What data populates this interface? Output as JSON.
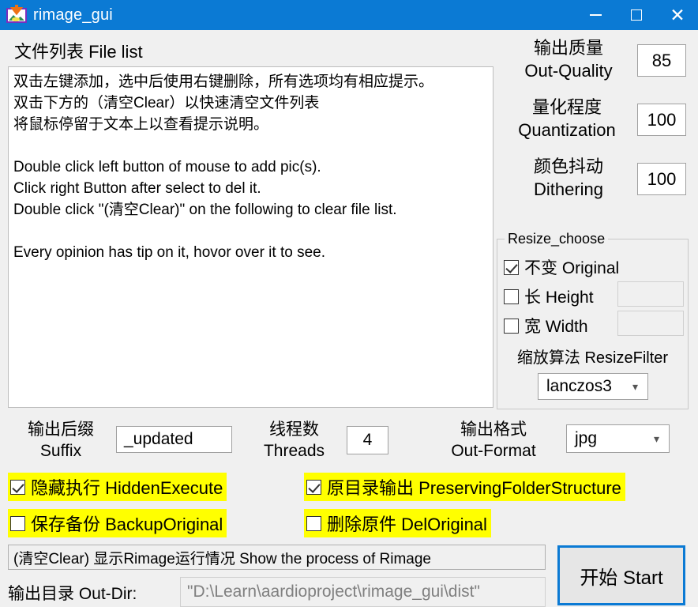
{
  "window": {
    "title": "rimage_gui",
    "icon": "picture-download-icon",
    "minimize_label": "—",
    "maximize_label": "□",
    "close_label": "✕",
    "titlebar_color": "#0b7ad4"
  },
  "file_list": {
    "title": "文件列表 File list",
    "content": "双击左键添加，选中后使用右键删除，所有选项均有相应提示。\n双击下方的（清空Clear）以快速清空文件列表\n将鼠标停留于文本上以查看提示说明。\n\nDouble click left button of mouse to add pic(s).\nClick right Button after select to del it.\nDouble click \"(清空Clear)\" on the following to clear file list.\n\nEvery opinion has tip on it, hovor over it to see."
  },
  "params": {
    "quality": {
      "label": "输出质量\nOut-Quality",
      "value": "85"
    },
    "quantization": {
      "label": "量化程度\nQuantization",
      "value": "100"
    },
    "dithering": {
      "label": "颜色抖动\nDithering",
      "value": "100"
    }
  },
  "resize": {
    "legend": "Resize_choose",
    "original": {
      "label": "不变 Original",
      "checked": true
    },
    "height": {
      "label": "长 Height",
      "checked": false,
      "value": ""
    },
    "width": {
      "label": "宽 Width",
      "checked": false,
      "value": ""
    },
    "filter_label": "缩放算法 ResizeFilter",
    "filter_value": "lanczos3",
    "filter_options": [
      "lanczos3"
    ]
  },
  "mid": {
    "suffix_label": "输出后缀\nSuffix",
    "suffix_value": "_updated",
    "threads_label": "线程数\nThreads",
    "threads_value": "4",
    "format_label": "输出格式\nOut-Format",
    "format_value": "jpg",
    "format_options": [
      "jpg"
    ]
  },
  "options": {
    "hidden_execute": {
      "label": "隐藏执行 HiddenExecute",
      "checked": true
    },
    "preserving_folder_structure": {
      "label": "原目录输出 PreservingFolderStructure",
      "checked": true
    },
    "backup_original": {
      "label": "保存备份 BackupOriginal",
      "checked": false
    },
    "del_original": {
      "label": "删除原件 DelOriginal",
      "checked": false
    },
    "highlight_color": "#ffff00"
  },
  "bottom": {
    "status_text": "(清空Clear) 显示Rimage运行情况 Show the process of Rimage",
    "outdir_label": "输出目录 Out-Dir:",
    "outdir_placeholder": "\"D:\\Learn\\aardioproject\\rimage_gui\\dist\"",
    "start_label": "开始 Start",
    "start_accent": "#0b7ad4"
  }
}
